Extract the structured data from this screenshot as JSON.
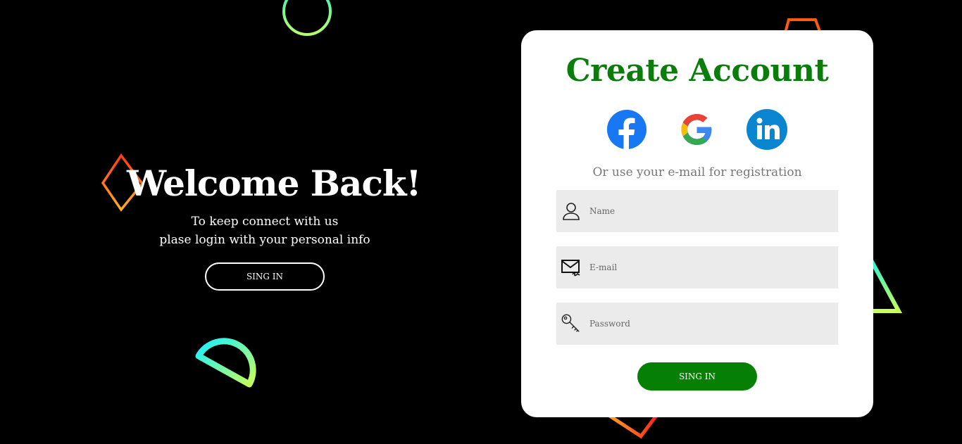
{
  "left_panel": {
    "title": "Welcome Back!",
    "subtitle_line1": "To keep connect with us",
    "subtitle_line2": "plase login with your personal info",
    "signin_button": "SING IN"
  },
  "card": {
    "title": "Create Account",
    "social": [
      "facebook-icon",
      "google-icon",
      "linkedin-icon"
    ],
    "hint": "Or use your e-mail for registration",
    "fields": {
      "name_placeholder": "Name",
      "email_placeholder": "E-mail",
      "password_placeholder": "Password"
    },
    "signin_button": "SING IN"
  },
  "colors": {
    "accent_green": "#058005",
    "background": "#000000",
    "card": "#ffffff",
    "field": "#ebebeb"
  }
}
